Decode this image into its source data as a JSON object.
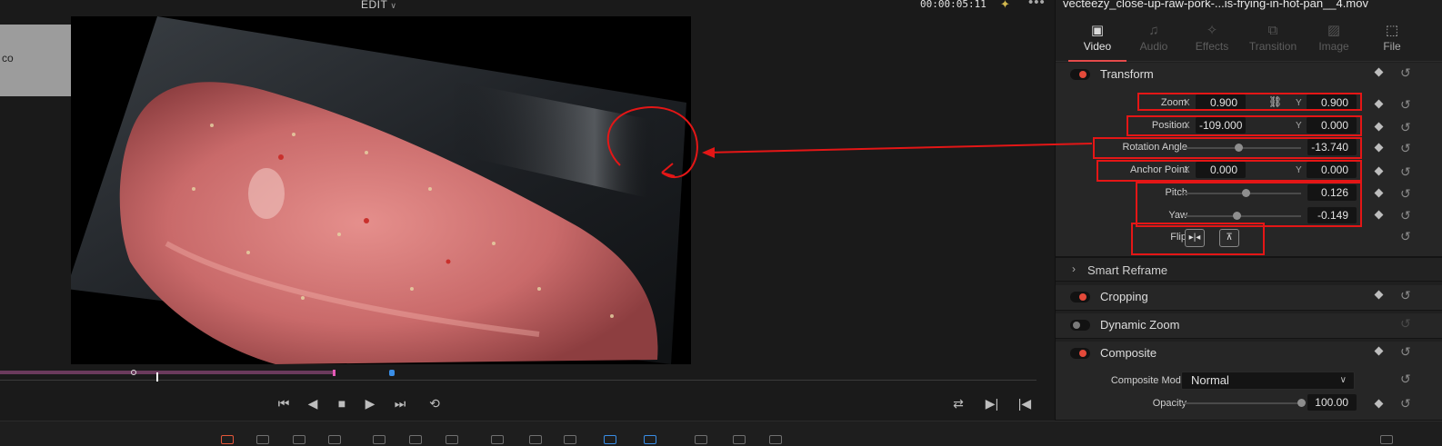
{
  "viewer": {
    "mode_label": "EDIT",
    "timecode": "00:00:05:11",
    "side_clip_text": "co"
  },
  "inspector": {
    "clip_title": "vecteezy_close-up-raw-pork-...is-frying-in-hot-pan__4.mov",
    "tabs": [
      {
        "label": "Video",
        "icon": "video-icon",
        "active": true
      },
      {
        "label": "Audio",
        "icon": "music-note-icon",
        "active": false
      },
      {
        "label": "Effects",
        "icon": "magic-wand-icon",
        "active": false
      },
      {
        "label": "Transition",
        "icon": "transition-icon",
        "active": false
      },
      {
        "label": "Image",
        "icon": "image-icon",
        "active": false
      },
      {
        "label": "File",
        "icon": "file-icon",
        "active": false
      }
    ],
    "transform": {
      "title": "Transform",
      "zoom": {
        "label": "Zoom",
        "x_axis": "X",
        "x": "0.900",
        "y_axis": "Y",
        "y": "0.900"
      },
      "position": {
        "label": "Position",
        "x_axis": "X",
        "x": "-109.000",
        "y_axis": "Y",
        "y": "0.000"
      },
      "rotation": {
        "label": "Rotation Angle",
        "value": "-13.740",
        "level": 0.47
      },
      "anchor": {
        "label": "Anchor Point",
        "x_axis": "X",
        "x": "0.000",
        "y_axis": "Y",
        "y": "0.000"
      },
      "pitch": {
        "label": "Pitch",
        "value": "0.126",
        "level": 0.53
      },
      "yaw": {
        "label": "Yaw",
        "value": "-0.149",
        "level": 0.45
      },
      "flip": {
        "label": "Flip"
      }
    },
    "smart_reframe": {
      "title": "Smart Reframe"
    },
    "cropping": {
      "title": "Cropping"
    },
    "dynamic_zoom": {
      "title": "Dynamic Zoom"
    },
    "composite": {
      "title": "Composite",
      "mode_label": "Composite Mode",
      "mode_value": "Normal",
      "opacity_label": "Opacity",
      "opacity_value": "100.00",
      "opacity_level": 1.0
    }
  },
  "colors": {
    "accent_red": "#e64b4b",
    "annotation_red": "#e41616",
    "panel_bg": "#1f1f1f"
  }
}
